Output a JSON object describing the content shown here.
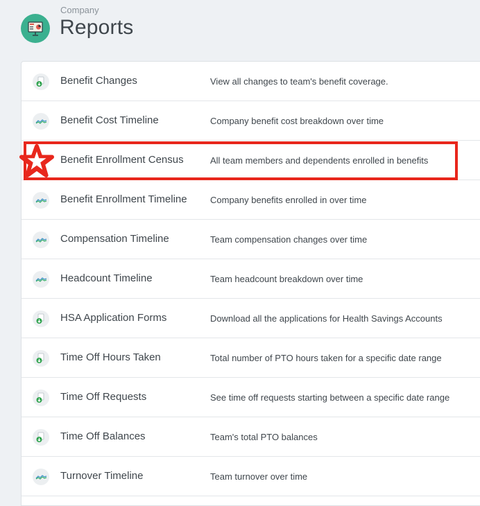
{
  "header": {
    "breadcrumb": "Company",
    "title": "Reports",
    "icon": "presentation-board-icon"
  },
  "accent_color": "#3bb08f",
  "highlight_color": "#e8271c",
  "reports": [
    {
      "title": "Benefit Changes",
      "description": "View all changes to team's benefit coverage.",
      "icon": "download-doc-icon"
    },
    {
      "title": "Benefit Cost Timeline",
      "description": "Company benefit cost breakdown over time",
      "icon": "timeline-chart-icon"
    },
    {
      "title": "Benefit Enrollment Census",
      "description": "All team members and dependents enrolled in benefits",
      "icon": "star-icon",
      "highlighted": true
    },
    {
      "title": "Benefit Enrollment Timeline",
      "description": "Company benefits enrolled in over time",
      "icon": "timeline-chart-icon"
    },
    {
      "title": "Compensation Timeline",
      "description": "Team compensation changes over time",
      "icon": "timeline-chart-icon"
    },
    {
      "title": "Headcount Timeline",
      "description": "Team headcount breakdown over time",
      "icon": "timeline-chart-icon"
    },
    {
      "title": "HSA Application Forms",
      "description": "Download all the applications for Health Savings Accounts",
      "icon": "download-doc-icon"
    },
    {
      "title": "Time Off Hours Taken",
      "description": "Total number of PTO hours taken for a specific date range",
      "icon": "download-doc-icon"
    },
    {
      "title": "Time Off Requests",
      "description": "See time off requests starting between a specific date range",
      "icon": "download-doc-icon"
    },
    {
      "title": "Time Off Balances",
      "description": "Team's total PTO balances",
      "icon": "download-doc-icon"
    },
    {
      "title": "Turnover Timeline",
      "description": "Team turnover over time",
      "icon": "timeline-chart-icon"
    }
  ]
}
